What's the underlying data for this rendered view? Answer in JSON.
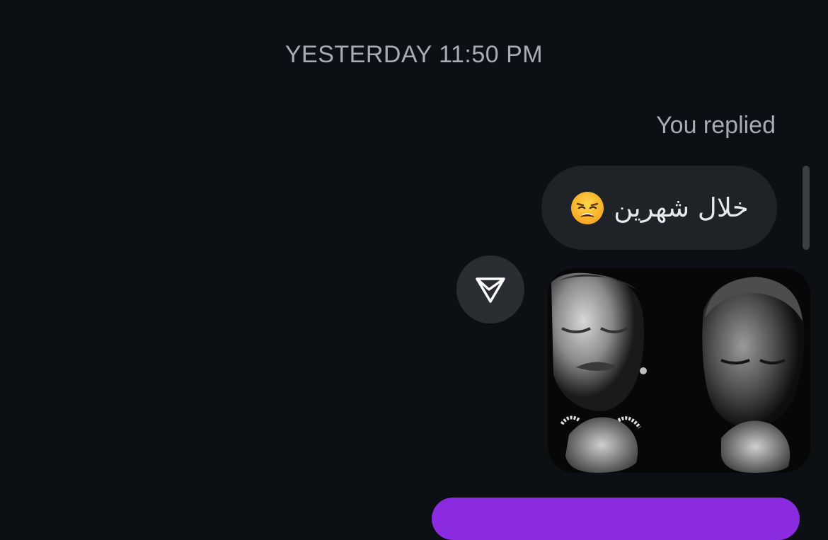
{
  "thread": {
    "timestamp": "YESTERDAY 11:50 PM",
    "reply_label": "You replied",
    "message": {
      "text": "خلال شهرين",
      "emoji": "weary-face-emoji"
    },
    "share_icon": "send-arrow-icon",
    "media": {
      "kind": "black-and-white photo of two men crying with clasped hands"
    }
  },
  "colors": {
    "background": "#0c1014",
    "bubble": "#1f2327",
    "accent": "#8a2be2"
  }
}
